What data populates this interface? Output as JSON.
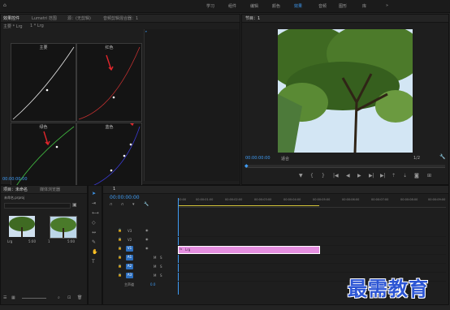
{
  "top_bar": {
    "workspaces": [
      "学习",
      "组件",
      "编辑",
      "颜色",
      "效果",
      "音频",
      "图形",
      "库"
    ],
    "active_workspace": "效果",
    "more": "»"
  },
  "effect_controls": {
    "tabs": [
      "效果控件",
      "Lumetri 范围",
      "源：(无剪辑)",
      "音频剪辑混合器：1"
    ],
    "clip_source": "主要 * Lrg",
    "clip_target": "1 * Lrg",
    "curve_labels": [
      "主要",
      "红色",
      "绿色",
      "蓝色"
    ],
    "timecode": "00:00:00:00",
    "curve_colors": [
      "#e6e6e6",
      "#c03030",
      "#3fb43f",
      "#3a3ad0"
    ],
    "arrow_color": "#e0262c"
  },
  "program_monitor": {
    "title": "节目：1",
    "timecode": "00:00:00:00",
    "fit": "适合",
    "ratio": "1/2",
    "controls": [
      "marker-icon",
      "in-point-icon",
      "out-point-icon",
      "go-to-in-icon",
      "step-back-icon",
      "play-icon",
      "step-forward-icon",
      "go-to-out-icon",
      "lift-icon",
      "extract-icon",
      "export-frame-icon",
      "settings-icon"
    ]
  },
  "project_panel": {
    "tabs": [
      "项目：未命名",
      "媒体浏览器"
    ],
    "path": "未命名.prproj",
    "items": [
      {
        "name": "Lrg",
        "duration": "5:00"
      },
      {
        "name": "1",
        "duration": "5:00"
      }
    ]
  },
  "timeline": {
    "tab": "1",
    "timecode": "00:00:00:00",
    "ruler": [
      "00:00",
      "00:00:01:00",
      "00:00:02:00",
      "00:00:03:00",
      "00:00:04:00",
      "00:00:05:00",
      "00:00:06:00",
      "00:00:07:00",
      "00:00:08:00",
      "00:00:09:00"
    ],
    "video_tracks": [
      "V3",
      "V2",
      "V1"
    ],
    "audio_tracks": [
      "A1",
      "A2",
      "A3"
    ],
    "master": "主声道",
    "master_val": "0.0",
    "clip_name": "Lrg",
    "clip_color": "#e58fe0"
  },
  "watermark": "最需教育"
}
